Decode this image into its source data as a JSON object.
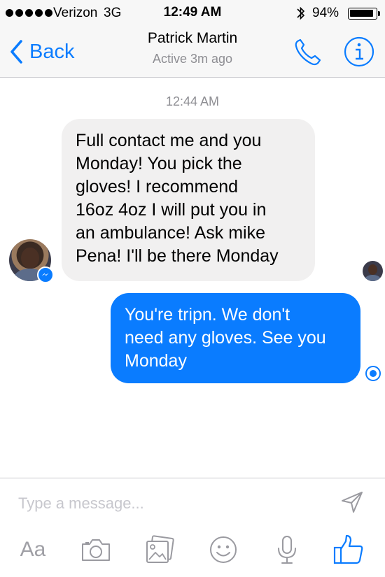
{
  "status_bar": {
    "carrier": "Verizon",
    "network": "3G",
    "time": "12:49 AM",
    "battery_percent_label": "94%",
    "battery_level": 0.94,
    "signal_dots": 5
  },
  "nav": {
    "back_label": "Back",
    "contact_name": "Patrick Martin",
    "contact_status": "Active 3m ago",
    "icons": [
      "chevron-left-icon",
      "phone-icon",
      "info-icon"
    ],
    "accent_color": "#0a7cff"
  },
  "conversation": {
    "timestamp": "12:44 AM",
    "incoming": {
      "lines": [
        "Full contact me and you",
        "Monday! You pick the",
        "gloves! I recommend",
        "16oz 4oz I will put you in",
        "an ambulance! Ask mike",
        "Pena! I'll be there Monday"
      ],
      "bubble_color": "#f1f0f0"
    },
    "outgoing": {
      "lines": [
        "You're tripn. We don't",
        "need any gloves. See you",
        "Monday"
      ],
      "bubble_color": "#0a7cff"
    }
  },
  "composer": {
    "placeholder": "Type a message...",
    "value": "",
    "aa_label": "Aa",
    "toolbar_icons": [
      "camera-icon",
      "gallery-icon",
      "sticker-icon",
      "microphone-icon",
      "thumbs-up-icon"
    ],
    "send_icon": "send-icon"
  }
}
